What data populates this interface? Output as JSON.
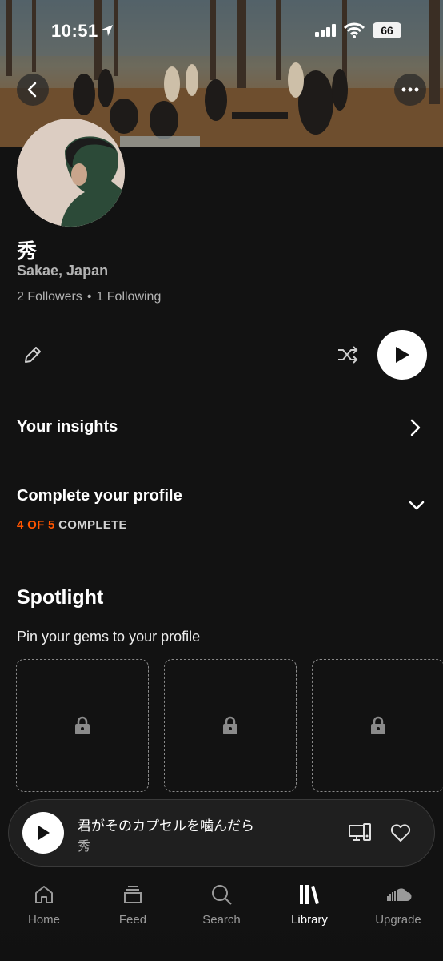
{
  "status_bar": {
    "time": "10:51",
    "battery": "66"
  },
  "profile": {
    "name": "秀",
    "location": "Sakae, Japan",
    "followers": "2 Followers",
    "separator": "•",
    "following": "1 Following"
  },
  "insights": {
    "label": "Your insights"
  },
  "complete_profile": {
    "label": "Complete your profile",
    "progress_count": "4 OF 5",
    "progress_suffix": "COMPLETE",
    "progress_value": 0.8
  },
  "spotlight": {
    "title": "Spotlight",
    "subtitle": "Pin your gems to your profile",
    "slots": [
      "lock-icon",
      "lock-icon",
      "lock-icon"
    ]
  },
  "now_playing": {
    "track": "君がそのカプセルを噛んだら",
    "artist": "秀"
  },
  "tabs": [
    {
      "label": "Home",
      "icon": "home-icon"
    },
    {
      "label": "Feed",
      "icon": "feed-icon"
    },
    {
      "label": "Search",
      "icon": "search-icon"
    },
    {
      "label": "Library",
      "icon": "library-icon",
      "active": true
    },
    {
      "label": "Upgrade",
      "icon": "cloud-icon"
    }
  ],
  "colors": {
    "accent": "#ff5500",
    "background": "#121212"
  }
}
